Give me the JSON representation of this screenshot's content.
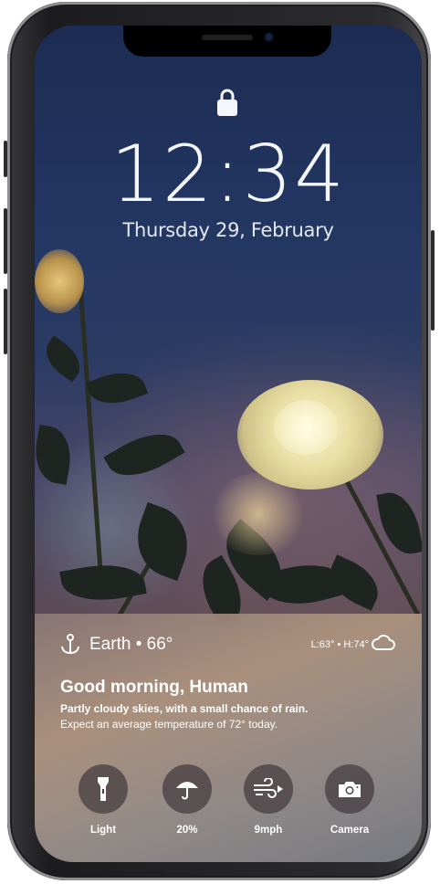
{
  "lockscreen": {
    "time": "12:34",
    "date": "Thursday 29, February"
  },
  "weather": {
    "location": "Earth • 66°",
    "high_low": "L:63° • H:74°",
    "location_icon": "anchor-icon",
    "condition_icon": "cloud-icon"
  },
  "message": {
    "greeting": "Good morning, Human",
    "summary": "Partly cloudy skies, with a small chance of rain.",
    "detail": "Expect an average temperature of 72° today."
  },
  "quick_actions": [
    {
      "label": "Light",
      "icon": "flashlight-icon"
    },
    {
      "label": "20%",
      "icon": "umbrella-icon"
    },
    {
      "label": "9mph",
      "icon": "wind-icon"
    },
    {
      "label": "Camera",
      "icon": "camera-icon"
    }
  ],
  "colors": {
    "screen_top": "#1c2c52",
    "panel": "#b09680",
    "button_bg": "#463e42"
  }
}
